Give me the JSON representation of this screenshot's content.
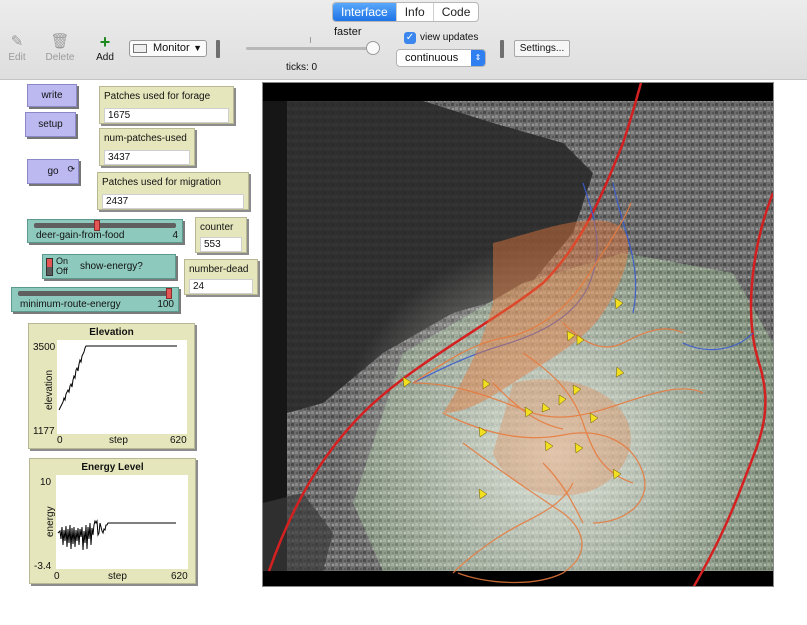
{
  "toolbar": {
    "tabs": [
      {
        "label": "Interface",
        "active": true
      },
      {
        "label": "Info",
        "active": false
      },
      {
        "label": "Code",
        "active": false
      }
    ],
    "edit_label": "Edit",
    "delete_label": "Delete",
    "add_label": "Add",
    "widget_type": "Monitor",
    "speed_label": "faster",
    "ticks_label": "ticks: 0",
    "view_updates_label": "view updates",
    "view_updates_checked": true,
    "update_mode": "continuous",
    "settings_label": "Settings..."
  },
  "buttons": {
    "write": "write",
    "setup": "setup",
    "go": "go"
  },
  "monitors": {
    "forage": {
      "label": "Patches used for forage",
      "value": "1675"
    },
    "num_patches": {
      "label": "num-patches-used",
      "value": "3437"
    },
    "migration": {
      "label": "Patches used for migration",
      "value": "2437"
    },
    "counter": {
      "label": "counter",
      "value": "553"
    },
    "number_dead": {
      "label": "number-dead",
      "value": "24"
    }
  },
  "sliders": {
    "deer_gain": {
      "name": "deer-gain-from-food",
      "value": "4",
      "fraction": 0.44
    },
    "min_route": {
      "name": "minimum-route-energy",
      "value": "100",
      "fraction": 1.0
    }
  },
  "switch": {
    "on_label": "On",
    "off_label": "Off",
    "name": "show-energy?"
  },
  "plots": {
    "elevation": {
      "title": "Elevation",
      "ylabel": "elevation",
      "xlabel": "step",
      "ymin_label": "1177",
      "ymax_label": "3500",
      "xmin_label": "0",
      "xmax_label": "620"
    },
    "energy": {
      "title": "Energy Level",
      "ylabel": "energy",
      "xlabel": "step",
      "ymin_label": "-3.4",
      "ymax_label": "10",
      "xmin_label": "0",
      "xmax_label": "620"
    }
  },
  "colors": {
    "button": "#bcb9f0",
    "monitor": "#e5e6bc",
    "slider": "#8ec9bd",
    "route": "#e87a3c",
    "boundary": "#d42020",
    "deer": "#f2e020",
    "trail_blue": "#3a5bd0"
  }
}
